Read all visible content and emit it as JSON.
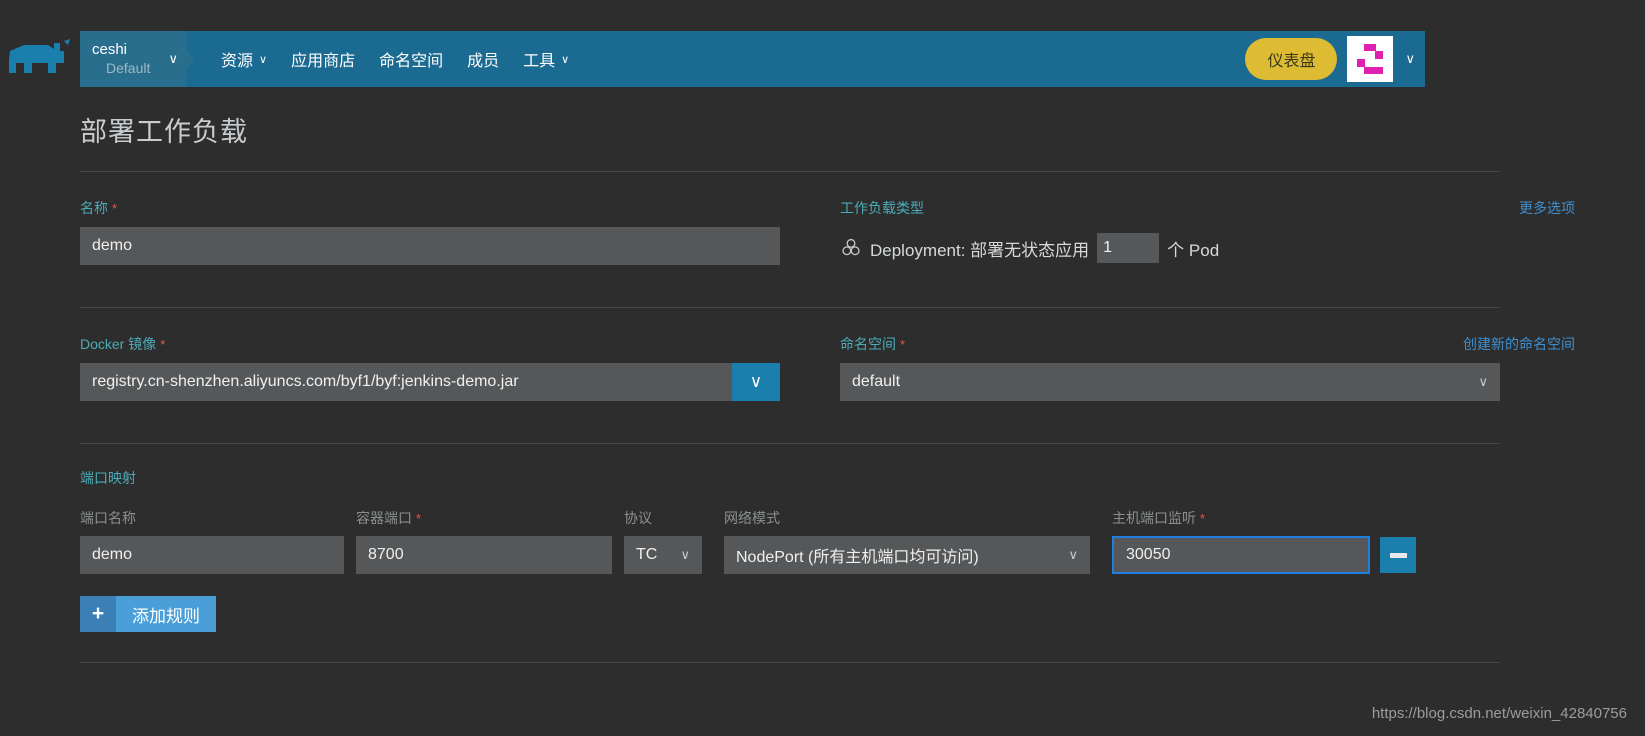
{
  "header": {
    "logo_icon": "rancher-cow-logo",
    "context": {
      "name": "ceshi",
      "subtitle": "Default",
      "caret_icon": "chevron-down-icon"
    },
    "nav": [
      {
        "label": "资源",
        "has_caret": true
      },
      {
        "label": "应用商店",
        "has_caret": false
      },
      {
        "label": "命名空间",
        "has_caret": false
      },
      {
        "label": "成员",
        "has_caret": false
      },
      {
        "label": "工具",
        "has_caret": true
      }
    ],
    "dashboard_button": "仪表盘",
    "avatar_icon": "user-avatar-identicon",
    "avatar_caret_icon": "chevron-down-icon",
    "caret_glyph": "∨",
    "bar_color": "#1b6a91",
    "dashboard_color": "#ddbb33"
  },
  "main": {
    "title": "部署工作负载",
    "name_field": {
      "label": "名称",
      "required": "*",
      "value": "demo"
    },
    "workload_type": {
      "label": "工作负载类型",
      "more_options_link": "更多选项",
      "icon": "deployment-icon",
      "description": "Deployment: 部署无状态应用",
      "pod_count": "1",
      "pod_suffix": "个 Pod"
    },
    "docker_image": {
      "label": "Docker 镜像",
      "required": "*",
      "value": "registry.cn-shenzhen.aliyuncs.com/byf1/byf:jenkins-demo.jar",
      "dropdown_icon": "chevron-down-icon"
    },
    "namespace": {
      "label": "命名空间",
      "required": "*",
      "value": "default",
      "create_link": "创建新的命名空间",
      "dropdown_icon": "chevron-down-icon"
    },
    "port_mapping": {
      "section_title": "端口映射",
      "columns": {
        "port_name": "端口名称",
        "container_port": "容器端口",
        "protocol": "协议",
        "network_mode": "网络模式",
        "host_port": "主机端口监听"
      },
      "required": "*",
      "rows": [
        {
          "port_name": "demo",
          "container_port": "8700",
          "protocol": "TC",
          "network_mode": "NodePort (所有主机端口均可访问)",
          "host_port": "30050",
          "host_port_focused": true,
          "remove_icon": "minus-icon"
        }
      ],
      "add_button": {
        "icon": "plus-icon",
        "label": "添加规则"
      }
    }
  },
  "watermark": "https://blog.csdn.net/weixin_42840756"
}
